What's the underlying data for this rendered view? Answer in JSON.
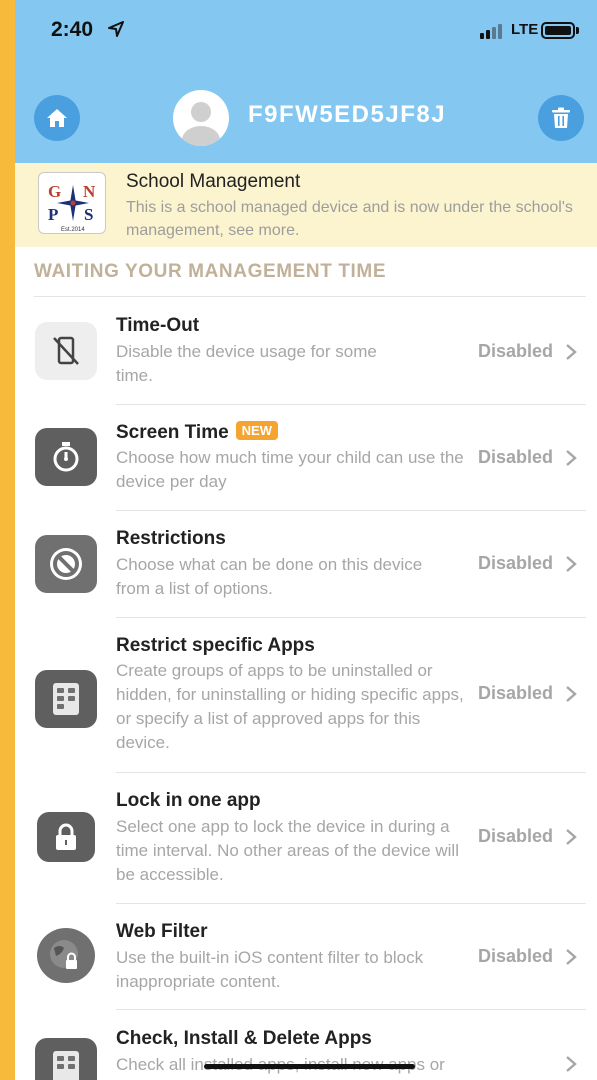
{
  "status_bar": {
    "time": "2:40",
    "network": "LTE"
  },
  "header": {
    "device_id": "F9FW5ED5JF8J"
  },
  "banner": {
    "title": "School Management",
    "description": "This is a school managed device and is now under the school's management, see more.",
    "logo_text": "G N P S Est.2014"
  },
  "section": {
    "title": "WAITING YOUR MANAGEMENT TIME"
  },
  "items": [
    {
      "title": "Time-Out",
      "description": "Disable the device usage for some time.",
      "status": "Disabled",
      "icon": "no-phone-icon"
    },
    {
      "title": "Screen Time",
      "badge": "NEW",
      "description": "Choose how much time your child can use the device per day",
      "status": "Disabled",
      "icon": "stopwatch-icon"
    },
    {
      "title": "Restrictions",
      "description": "Choose what can be done on this device from a list of options.",
      "status": "Disabled",
      "icon": "prohibited-icon"
    },
    {
      "title": "Restrict specific Apps",
      "description": "Create groups of apps to be uninstalled or hidden, for uninstalling or hiding specific apps, or specify a list of approved apps for this device.",
      "status": "Disabled",
      "icon": "app-grid-icon"
    },
    {
      "title": "Lock in one app",
      "description": "Select one app to lock the device in during a time interval. No other areas of the device will be accessible.",
      "status": "Disabled",
      "icon": "lock-icon"
    },
    {
      "title": "Web Filter",
      "description": "Use the built-in iOS content filter to block inappropriate content.",
      "status": "Disabled",
      "icon": "globe-lock-icon"
    },
    {
      "title": "Check, Install & Delete Apps",
      "description": "Check all installed apps, install new apps or",
      "status": "",
      "icon": "app-grid-icon"
    }
  ],
  "colors": {
    "header_bg": "#84c8f1",
    "accent_blue": "#4a9fdf",
    "banner_bg": "#fcf3cf",
    "badge": "#f5a430",
    "side_strip": "#f7ba3a"
  }
}
